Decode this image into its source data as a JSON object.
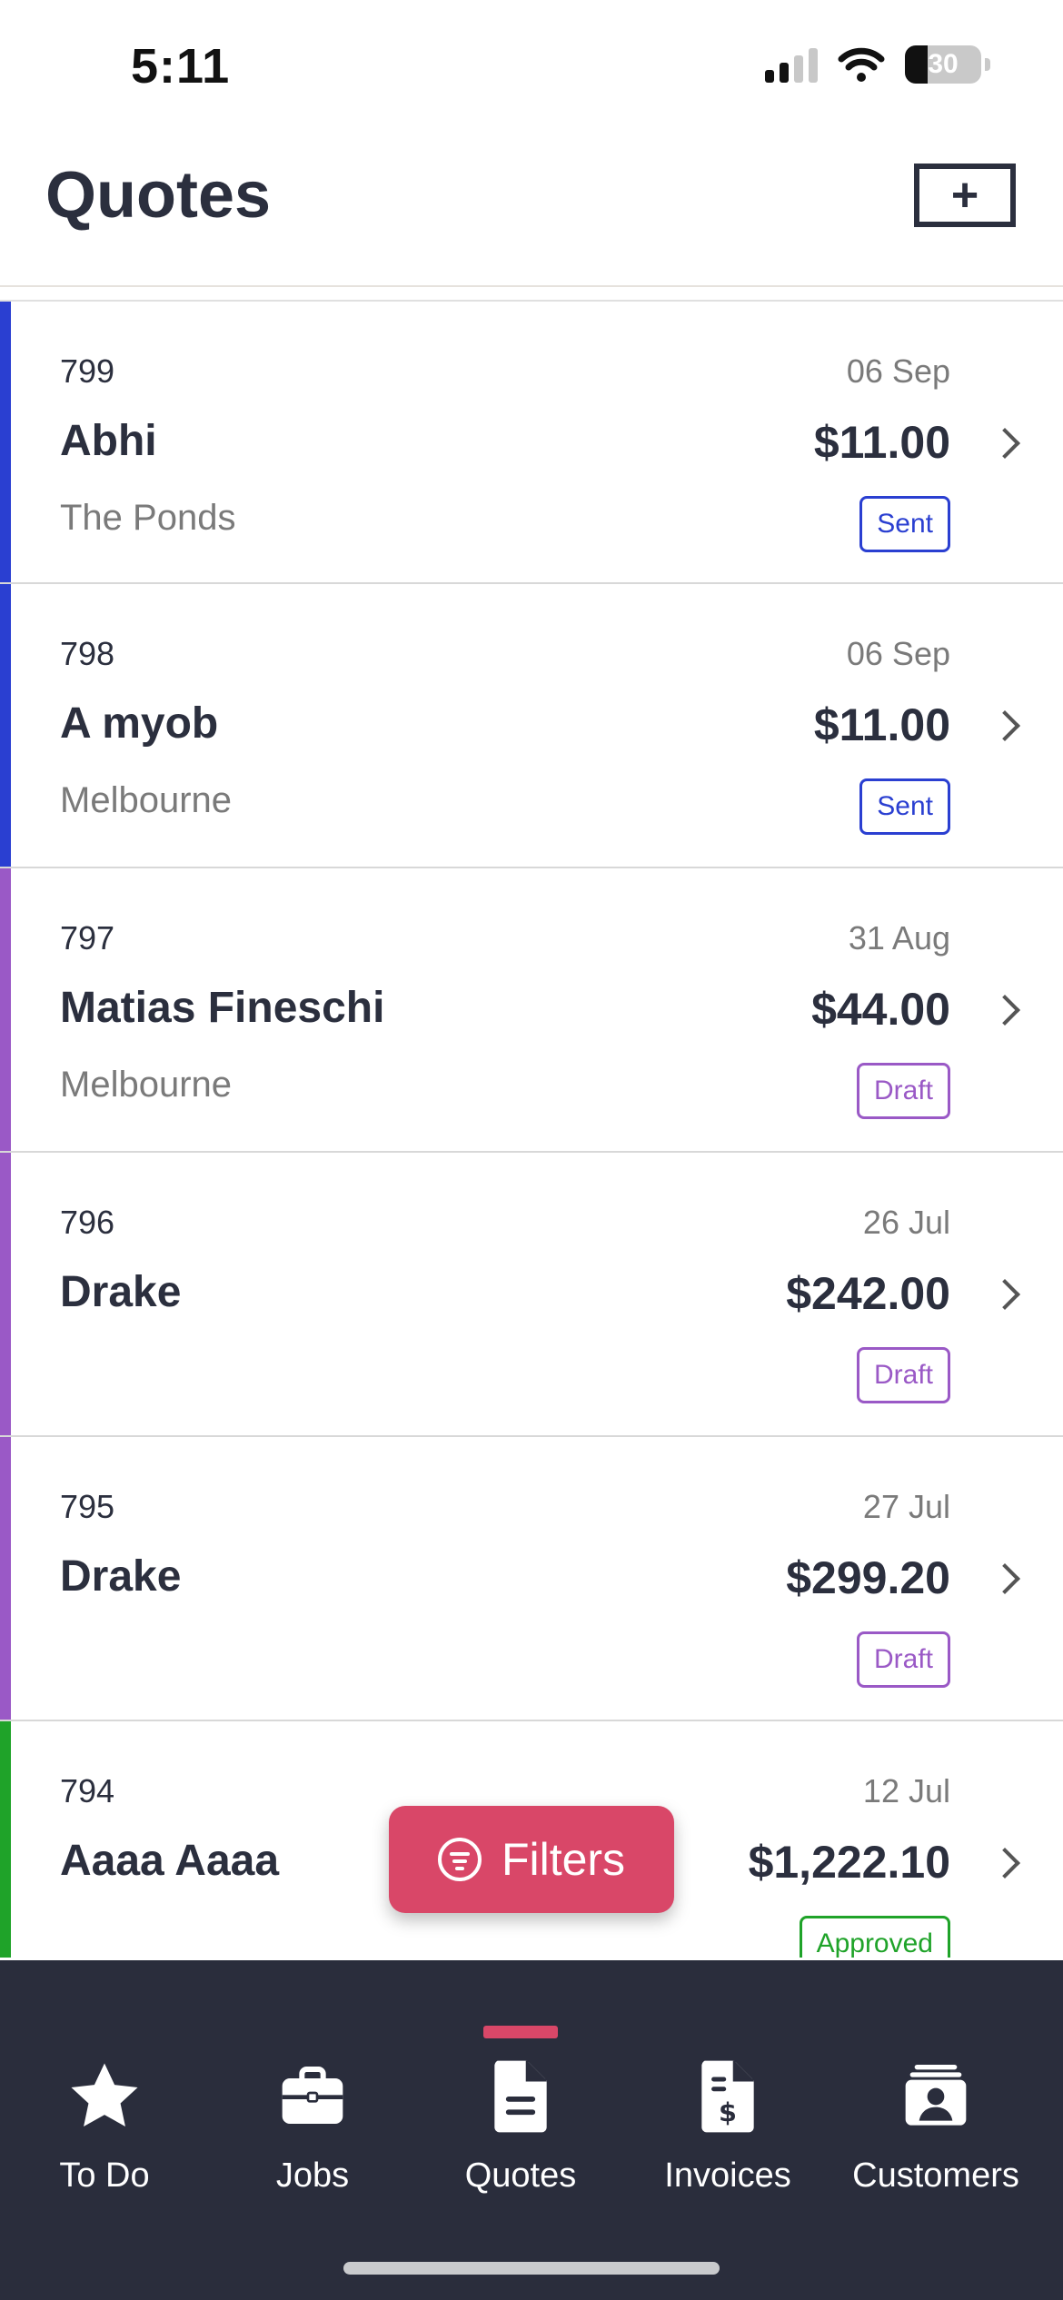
{
  "status_bar": {
    "time": "5:11",
    "battery": "30"
  },
  "header": {
    "title": "Quotes",
    "add_label": "+"
  },
  "colors": {
    "sent": "#2a3fd1",
    "draft": "#9a59c6",
    "approved": "#1fa329",
    "accent": "#d94768",
    "tab_bar": "#2a2d3c"
  },
  "quotes": [
    {
      "number": "799",
      "date": "06 Sep",
      "customer": "Abhi",
      "amount": "$11.00",
      "location": "The Ponds",
      "status": "Sent",
      "color": "#2a3fd1"
    },
    {
      "number": "798",
      "date": "06 Sep",
      "customer": "A myob",
      "amount": "$11.00",
      "location": "Melbourne",
      "status": "Sent",
      "color": "#2a3fd1"
    },
    {
      "number": "797",
      "date": "31 Aug",
      "customer": "Matias Fineschi",
      "amount": "$44.00",
      "location": "Melbourne",
      "status": "Draft",
      "color": "#9a59c6"
    },
    {
      "number": "796",
      "date": "26 Jul",
      "customer": "Drake",
      "amount": "$242.00",
      "location": "",
      "status": "Draft",
      "color": "#9a59c6"
    },
    {
      "number": "795",
      "date": "27 Jul",
      "customer": "Drake",
      "amount": "$299.20",
      "location": "",
      "status": "Draft",
      "color": "#9a59c6"
    },
    {
      "number": "794",
      "date": "12 Jul",
      "customer": "Aaaa Aaaa",
      "amount": "$1,222.10",
      "location": "",
      "status": "Approved",
      "color": "#1fa329"
    }
  ],
  "filters_button": {
    "label": "Filters"
  },
  "tabs": [
    {
      "label": "To Do",
      "icon": "star-icon"
    },
    {
      "label": "Jobs",
      "icon": "briefcase-icon"
    },
    {
      "label": "Quotes",
      "icon": "document-icon",
      "active": true
    },
    {
      "label": "Invoices",
      "icon": "invoice-icon"
    },
    {
      "label": "Customers",
      "icon": "customer-card-icon"
    }
  ]
}
